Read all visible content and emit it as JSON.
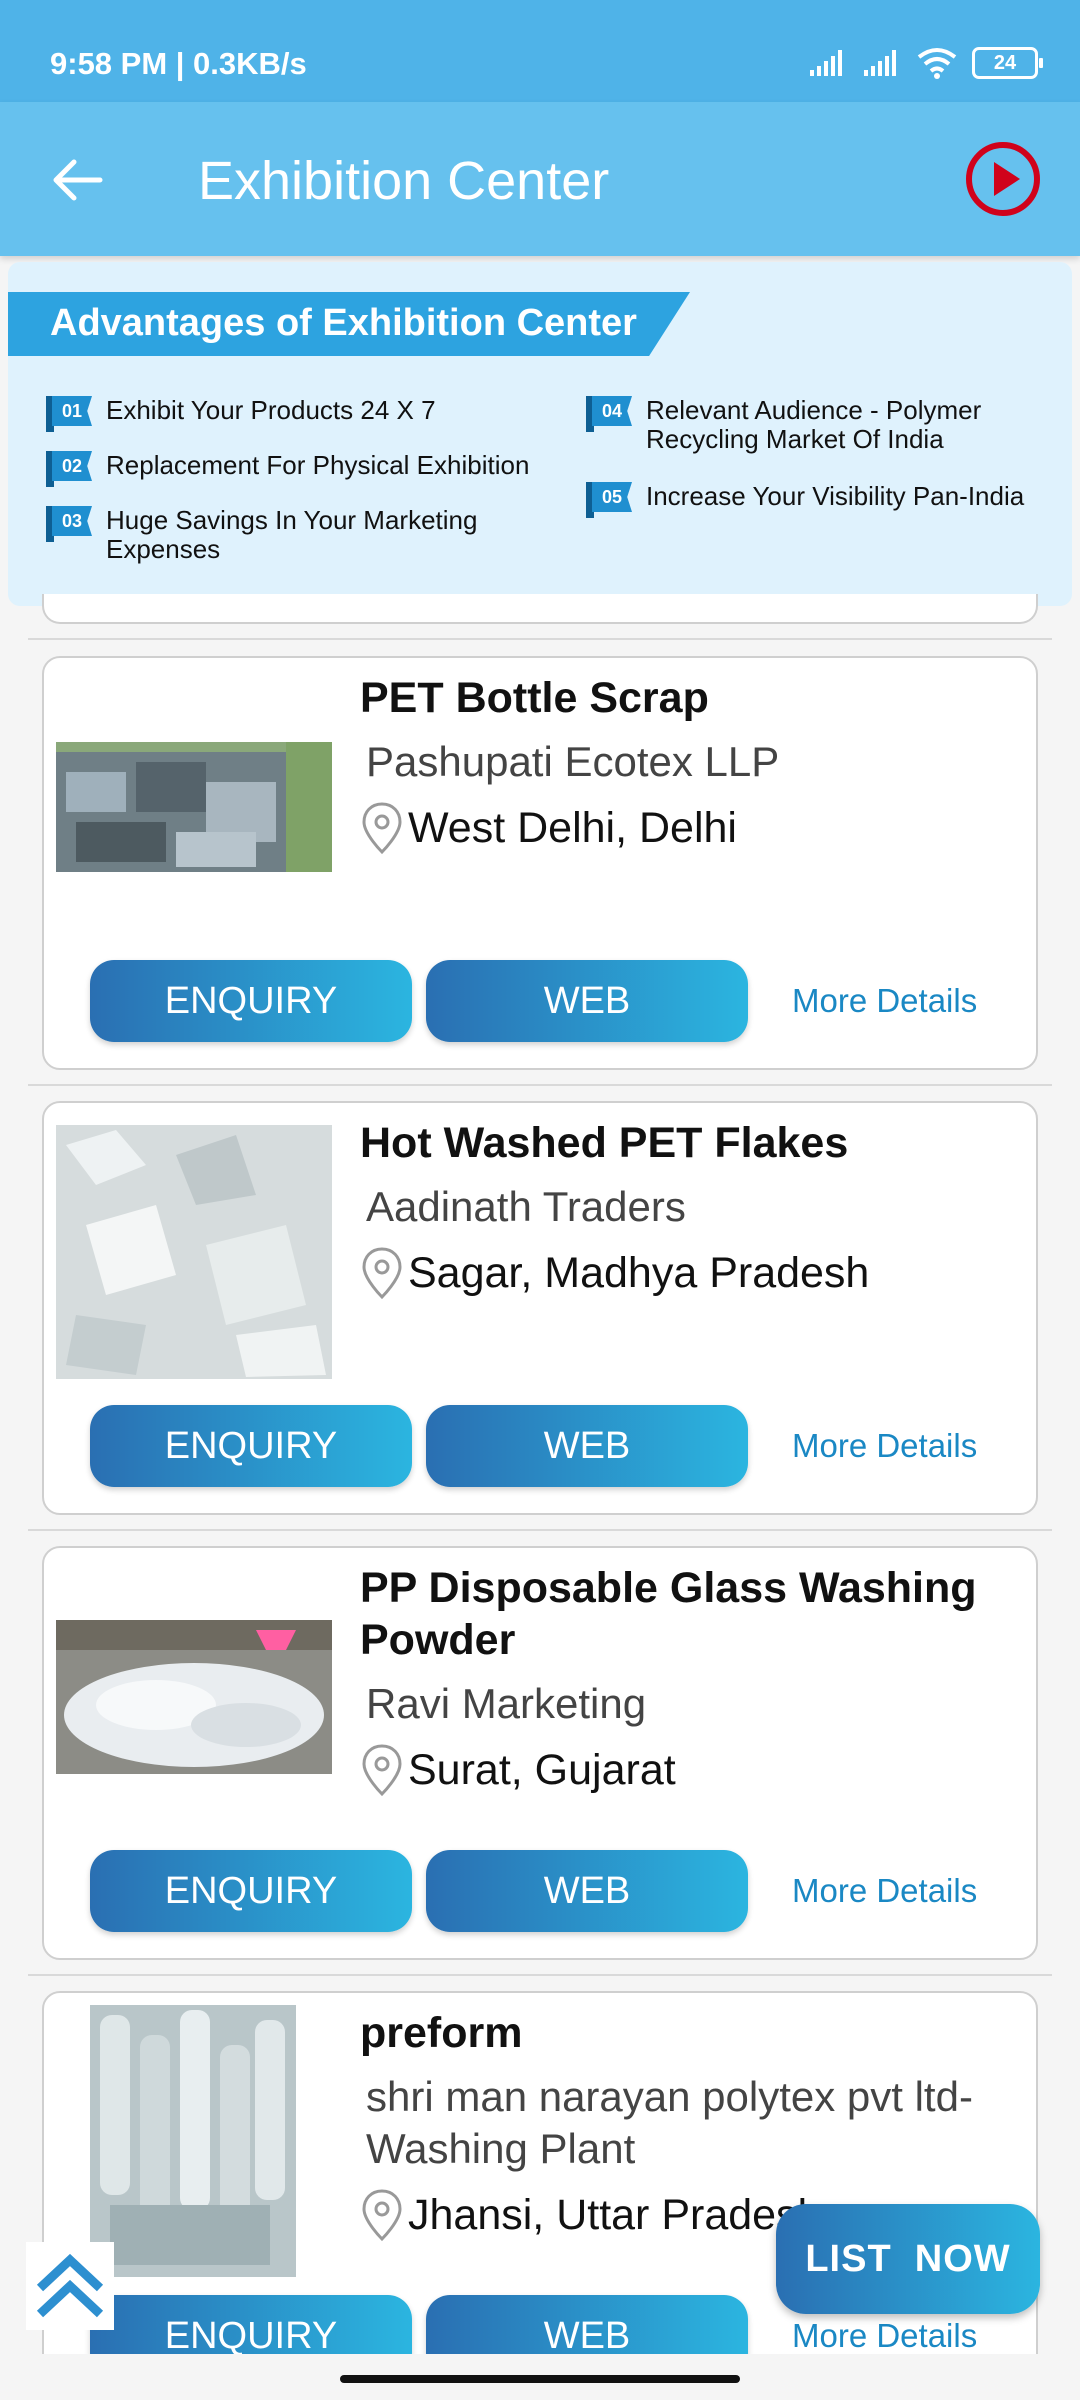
{
  "status_bar": {
    "time": "9:58 PM | 0.3KB/s",
    "battery": "24"
  },
  "app_bar": {
    "title": "Exhibition Center"
  },
  "banner": {
    "title": "Advantages of Exhibition Center",
    "items": [
      {
        "num": "01",
        "text": "Exhibit Your Products 24 X 7"
      },
      {
        "num": "02",
        "text": "Replacement For Physical Exhibition"
      },
      {
        "num": "03",
        "text": "Huge Savings In Your Marketing Expenses"
      },
      {
        "num": "04",
        "text": "Relevant Audience - Polymer Recycling Market Of India"
      },
      {
        "num": "05",
        "text": "Increase Your Visibility Pan-India"
      }
    ]
  },
  "listings": [
    {
      "product": "PET Bottle Scrap",
      "company": "Pashupati Ecotex LLP",
      "location": "West Delhi, Delhi",
      "enquiry": "ENQUIRY",
      "web": "WEB",
      "more": "More Details"
    },
    {
      "product": "Hot Washed PET Flakes",
      "company": "Aadinath Traders",
      "location": "Sagar, Madhya Pradesh",
      "enquiry": "ENQUIRY",
      "web": "WEB",
      "more": "More Details"
    },
    {
      "product": "PP Disposable Glass Washing Powder",
      "company": "Ravi Marketing",
      "location": "Surat, Gujarat",
      "enquiry": "ENQUIRY",
      "web": "WEB",
      "more": "More Details"
    },
    {
      "product": "preform",
      "company": "shri man narayan polytex pvt ltd-Washing Plant",
      "location": "Jhansi, Uttar Pradesh",
      "enquiry": "ENQUIRY",
      "web": "WEB",
      "more": "More Details"
    }
  ],
  "fab": {
    "label": "LIST  NOW"
  },
  "colors": {
    "status_bar": "#4fb3e8",
    "app_bar": "#66c1ee",
    "banner_bg": "#dff2fd",
    "ribbon": "#2da3e0",
    "button_start": "#2a6fb2",
    "button_end": "#2bb5e0",
    "link": "#1a88c4",
    "play_icon": "#d0021b"
  }
}
